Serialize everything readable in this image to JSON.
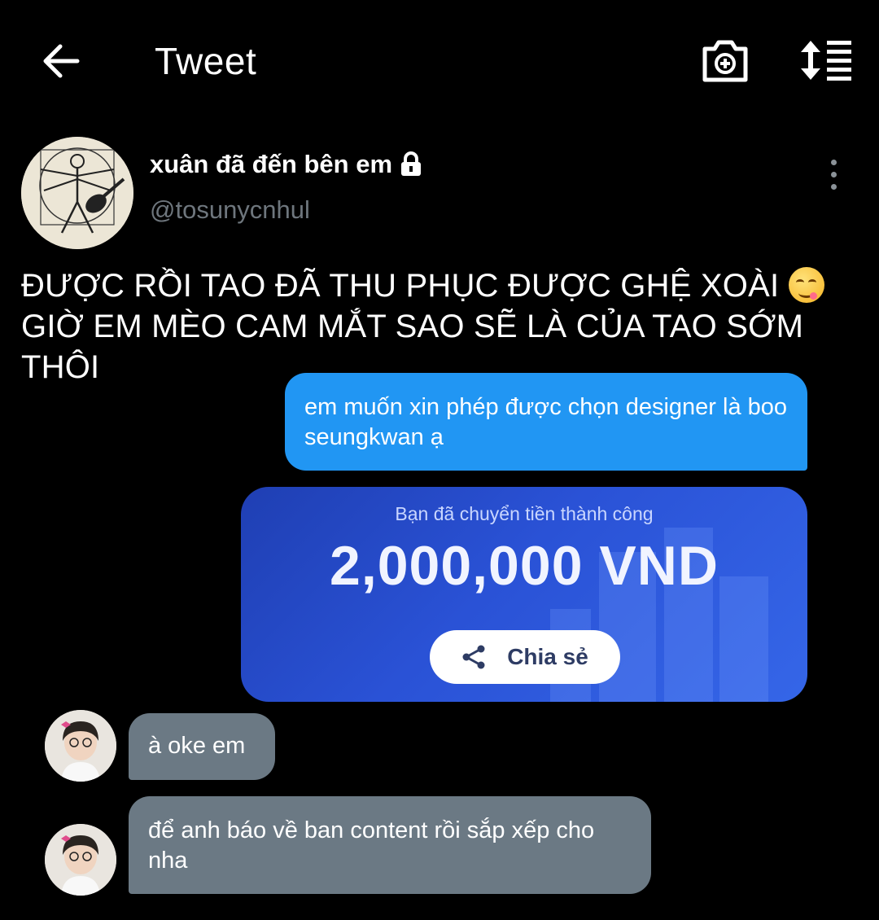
{
  "header": {
    "title": "Tweet",
    "back_icon": "arrow-left-icon",
    "camera_icon": "camera-plus-icon",
    "sort_icon": "sort-list-icon"
  },
  "author": {
    "display_name": "xuân đã đến bên em",
    "handle": "@tosunycnhul",
    "protected_icon": "lock-icon"
  },
  "tweet": {
    "text_before_emoji": "ĐƯỢC RỒI TAO ĐÃ THU PHỤC ĐƯỢC GHỆ XOÀI",
    "emoji": "face-savoring-food",
    "text_after_emoji": "GIỜ EM MÈO CAM MẮT SAO SẼ LÀ CỦA TAO SỚM THÔI"
  },
  "chat": {
    "outgoing": "em muốn xin phép được chọn designer là boo seungkwan ạ",
    "transfer": {
      "caption": "Bạn đã chuyển tiền thành công",
      "amount": "2,000,000 VND",
      "share_label": "Chia sẻ"
    },
    "incoming": [
      {
        "text": "à oke em"
      },
      {
        "text": "để anh báo về ban content rồi sắp xếp cho nha"
      }
    ]
  },
  "colors": {
    "background": "#000000",
    "outgoing_bubble": "#2196f3",
    "incoming_bubble": "#6b7984",
    "handle_gray": "#6e767d"
  }
}
